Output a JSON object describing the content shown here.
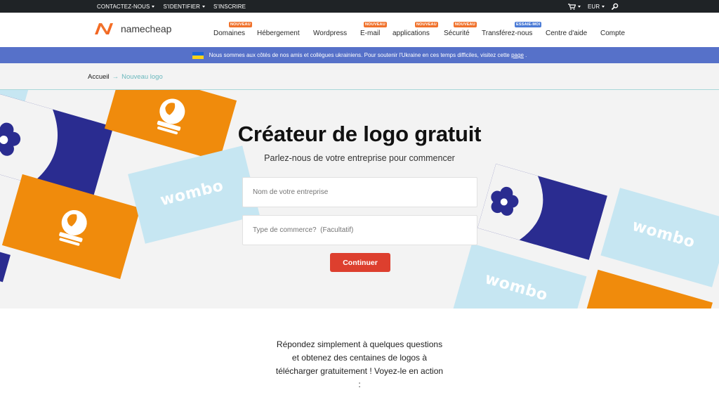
{
  "topbar": {
    "contact": "CONTACTEZ-NOUS",
    "signin": "S'IDENTIFIER",
    "register": "S'INSCRIRE",
    "currency": "EUR"
  },
  "logo": {
    "text": "namecheap"
  },
  "nav": [
    {
      "label": "Domaines",
      "badge": "NOUVEAU"
    },
    {
      "label": "Hébergement",
      "badge": ""
    },
    {
      "label": "Wordpress",
      "badge": ""
    },
    {
      "label": "E-mail",
      "badge": "NOUVEAU"
    },
    {
      "label": "applications",
      "badge": "NOUVEAU"
    },
    {
      "label": "Sécurité",
      "badge": "NOUVEAU"
    },
    {
      "label": "Transférez-nous",
      "badge": "ESSAIE-MOI"
    },
    {
      "label": "Centre d'aide",
      "badge": ""
    },
    {
      "label": "Compte",
      "badge": ""
    }
  ],
  "banner": {
    "text": "Nous sommes aux côtés de nos amis et collègues ukrainiens. Pour soutenir l'Ukraine en ces temps difficiles, visitez cette",
    "link": "page",
    "after": "."
  },
  "breadcrumb": {
    "home": "Accueil",
    "arrow": "→",
    "current": "Nouveau logo"
  },
  "hero": {
    "title": "Créateur de logo gratuit",
    "subtitle": "Parlez-nous de votre entreprise pour commencer",
    "business_placeholder": "Nom de votre entreprise",
    "type_placeholder": "Type de commerce?  (Facultatif)",
    "button": "Continuer",
    "tile_word": "wombo"
  },
  "intro": {
    "text": "Répondez simplement à quelques questions et obtenez des centaines de logos à télécharger gratuitement ! Voyez-le en action :"
  },
  "colors": {
    "accent": "#dd3f2e",
    "banner": "#5671c9",
    "badge_orange": "#f0722c",
    "badge_blue": "#4b7bd6",
    "tile_orange": "#f08b0c",
    "tile_navy": "#2a2c90",
    "tile_light": "#c6e6f2"
  }
}
